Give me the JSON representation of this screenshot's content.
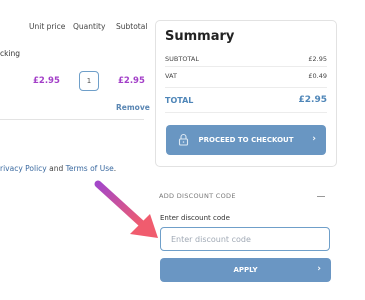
{
  "cart": {
    "headers": {
      "unit_price": "Unit price",
      "quantity": "Quantity",
      "subtotal": "Subtotal"
    },
    "item": {
      "desc_fragment": "cking",
      "unit_price": "£2.95",
      "quantity": "1",
      "subtotal": "£2.95",
      "remove_label": "Remove"
    },
    "policy": {
      "prefix": "rivacy Policy",
      "and": " and ",
      "terms": "Terms of Use",
      "suffix": "."
    }
  },
  "summary": {
    "title": "Summary",
    "subtotal_label": "SUBTOTAL",
    "subtotal_value": "£2.95",
    "vat_label": "VAT",
    "vat_value": "£0.49",
    "total_label": "TOTAL",
    "total_value": "£2.95",
    "checkout_label": "PROCEED TO CHECKOUT",
    "checkout_icon": "lock-icon"
  },
  "discount": {
    "section_title": "ADD DISCOUNT CODE",
    "field_label": "Enter discount code",
    "placeholder": "Enter discount code",
    "apply_label": "APPLY"
  },
  "colors": {
    "accent_blue": "#6996c2",
    "price_purple": "#a33fc8",
    "arrow_start": "#a347c9",
    "arrow_end": "#f05c6e"
  }
}
